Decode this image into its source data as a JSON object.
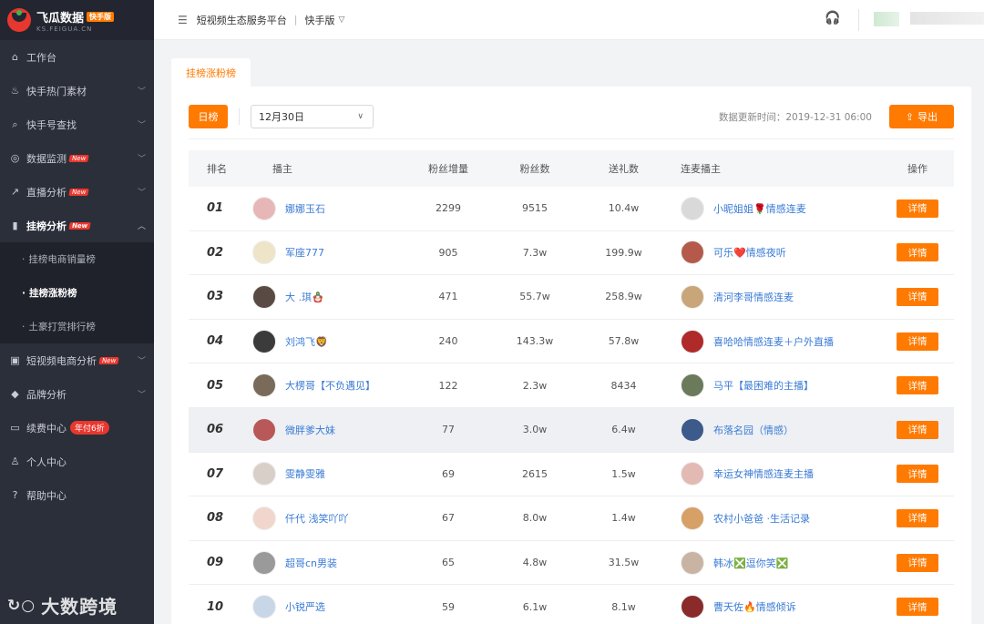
{
  "brand": {
    "name": "飞瓜数据",
    "badge": "快手版",
    "domain": "KS.FEIGUA.CN"
  },
  "sidebar": {
    "items": [
      {
        "label": "工作台",
        "icon": "home-icon",
        "chevron": false
      },
      {
        "label": "快手热门素材",
        "icon": "fire-icon",
        "chevron": true
      },
      {
        "label": "快手号查找",
        "icon": "search-icon",
        "chevron": true
      },
      {
        "label": "数据监测",
        "icon": "monitor-icon",
        "chevron": true,
        "tag": "New"
      },
      {
        "label": "直播分析",
        "icon": "live-icon",
        "chevron": true,
        "tag": "New"
      },
      {
        "label": "挂榜分析",
        "icon": "bar-chart-icon",
        "chevron": true,
        "tag": "New",
        "open": true
      }
    ],
    "sub_items": [
      {
        "label": "挂榜电商销量榜",
        "active": false
      },
      {
        "label": "挂榜涨粉榜",
        "active": true
      },
      {
        "label": "土豪打赏排行榜",
        "active": false
      }
    ],
    "items_after": [
      {
        "label": "短视频电商分析",
        "icon": "bag-icon",
        "chevron": true,
        "tag": "New"
      },
      {
        "label": "品牌分析",
        "icon": "diamond-icon",
        "chevron": true
      },
      {
        "label": "续费中心",
        "icon": "card-icon",
        "chevron": false,
        "promo": "年付6折"
      },
      {
        "label": "个人中心",
        "icon": "user-icon",
        "chevron": false
      },
      {
        "label": "帮助中心",
        "icon": "help-icon",
        "chevron": false
      }
    ],
    "watermark": "大数跨境"
  },
  "topbar": {
    "platform": "短视频生态服务平台",
    "separator": "|",
    "version": "快手版"
  },
  "tab": {
    "label": "挂榜涨粉榜"
  },
  "toolbar": {
    "day_button": "日榜",
    "date_value": "12月30日",
    "update_label": "数据更新时间：2019-12-31 06:00",
    "export_label": "导出"
  },
  "table": {
    "headers": {
      "rank": "排名",
      "streamer": "播主",
      "fans_increase": "粉丝增量",
      "fans": "粉丝数",
      "gifts": "送礼数",
      "linked": "连麦播主",
      "action": "操作"
    },
    "rows": [
      {
        "rank": "01",
        "name": "娜娜玉石",
        "inc": "2299",
        "fans": "9515",
        "gifts": "10.4w",
        "linked": "小昵姐姐🌹情感连麦",
        "btn": "详情",
        "av1": "#e7b7b7",
        "av2": "#d9d9d9"
      },
      {
        "rank": "02",
        "name": "军座777",
        "inc": "905",
        "fans": "7.3w",
        "gifts": "199.9w",
        "linked": "可乐❤️情感夜听",
        "btn": "详情",
        "av1": "#eee4c8",
        "av2": "#b55a4a"
      },
      {
        "rank": "03",
        "name": "大 .琪🪆",
        "inc": "471",
        "fans": "55.7w",
        "gifts": "258.9w",
        "linked": "清河李哥情感连麦",
        "btn": "详情",
        "av1": "#5a4a44",
        "av2": "#c9a57a"
      },
      {
        "rank": "04",
        "name": "刘鸿飞🦁",
        "inc": "240",
        "fans": "143.3w",
        "gifts": "57.8w",
        "linked": "喜哈哈情感连麦＋户外直播",
        "btn": "详情",
        "av1": "#3b3b3b",
        "av2": "#b02a2a"
      },
      {
        "rank": "05",
        "name": "大楞哥【不负遇见】",
        "inc": "122",
        "fans": "2.3w",
        "gifts": "8434",
        "linked": "马平【最困难的主播】",
        "btn": "详情",
        "av1": "#7a6a5a",
        "av2": "#6b7a5a"
      },
      {
        "rank": "06",
        "name": "微胖爹大妹",
        "inc": "77",
        "fans": "3.0w",
        "gifts": "6.4w",
        "linked": "布落名园（情感）",
        "btn": "详情",
        "av1": "#b85858",
        "av2": "#3c5a8a"
      },
      {
        "rank": "07",
        "name": "雯静雯雅",
        "inc": "69",
        "fans": "2615",
        "gifts": "1.5w",
        "linked": "幸运女神情感连麦主播",
        "btn": "详情",
        "av1": "#d8d0c8",
        "av2": "#e3b9b4"
      },
      {
        "rank": "08",
        "name": "仟代 浅笑吖吖",
        "inc": "67",
        "fans": "8.0w",
        "gifts": "1.4w",
        "linked": "农村小爸爸 ·生活记录",
        "btn": "详情",
        "av1": "#f0d6cc",
        "av2": "#d7a067"
      },
      {
        "rank": "09",
        "name": "超哥cn男装",
        "inc": "65",
        "fans": "4.8w",
        "gifts": "31.5w",
        "linked": "韩冰❎逗你笑❎",
        "btn": "详情",
        "av1": "#9a9a9a",
        "av2": "#c9b4a4"
      },
      {
        "rank": "10",
        "name": "小锐严选",
        "inc": "59",
        "fans": "6.1w",
        "gifts": "8.1w",
        "linked": "曹天佐🔥情感倾诉",
        "btn": "详情",
        "av1": "#c8d6e8",
        "av2": "#8a2a2a"
      }
    ]
  },
  "colors": {
    "accent": "#ff7a00",
    "sidebar_bg": "#2b2f3a",
    "link": "#3a7bd5",
    "new_tag": "#e8372e"
  }
}
